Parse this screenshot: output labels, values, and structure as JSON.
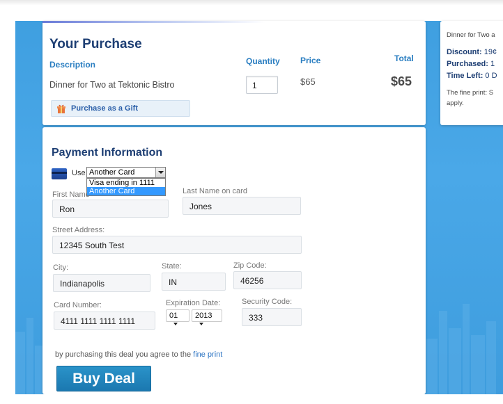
{
  "purchase": {
    "title": "Your Purchase",
    "description_header": "Description",
    "quantity_header": "Quantity",
    "price_header": "Price",
    "total_header": "Total",
    "item_description": "Dinner for Two at Tektonic Bistro",
    "quantity_value": "1",
    "price_value": "$65",
    "total_value": "$65",
    "gift_label": "Purchase as a Gift"
  },
  "payment": {
    "title": "Payment Information",
    "use_label": "Use",
    "card_select_value": "Another Card",
    "card_options": [
      "Visa ending in 1111",
      "Another Card"
    ],
    "first_name_label": "First Name",
    "first_name_value": "Ron",
    "last_name_label": "Last Name on card",
    "last_name_value": "Jones",
    "street_label": "Street Address:",
    "street_value": "12345 South Test",
    "city_label": "City:",
    "city_value": "Indianapolis",
    "state_label": "State:",
    "state_value": "IN",
    "zip_label": "Zip Code:",
    "zip_value": "46256",
    "card_number_label": "Card Number:",
    "card_number_value": "4111 1111 1111 1111",
    "expiration_label": "Expiration Date:",
    "exp_month_value": "01",
    "exp_year_value": "2013",
    "security_label": "Security Code:",
    "security_value": "333",
    "terms_text": "by purchasing this deal you agree to the",
    "terms_link": "fine print",
    "buy_button": "Buy Deal"
  },
  "sidebar": {
    "deal_title": "Dinner for Two a",
    "discount_label": "Discount:",
    "discount_value": "19¢",
    "purchased_label": "Purchased:",
    "purchased_value": "1",
    "time_left_label": "Time Left:",
    "time_left_value": "0 D",
    "fine_print_line1": "The fine print: S",
    "fine_print_line2": "apply."
  },
  "colors": {
    "background_blue": "#3f9fe0",
    "heading_navy": "#1d3e73",
    "link_blue": "#2a7ec1",
    "button_blue": "#1b78b0",
    "selected_option": "#3399ff"
  }
}
